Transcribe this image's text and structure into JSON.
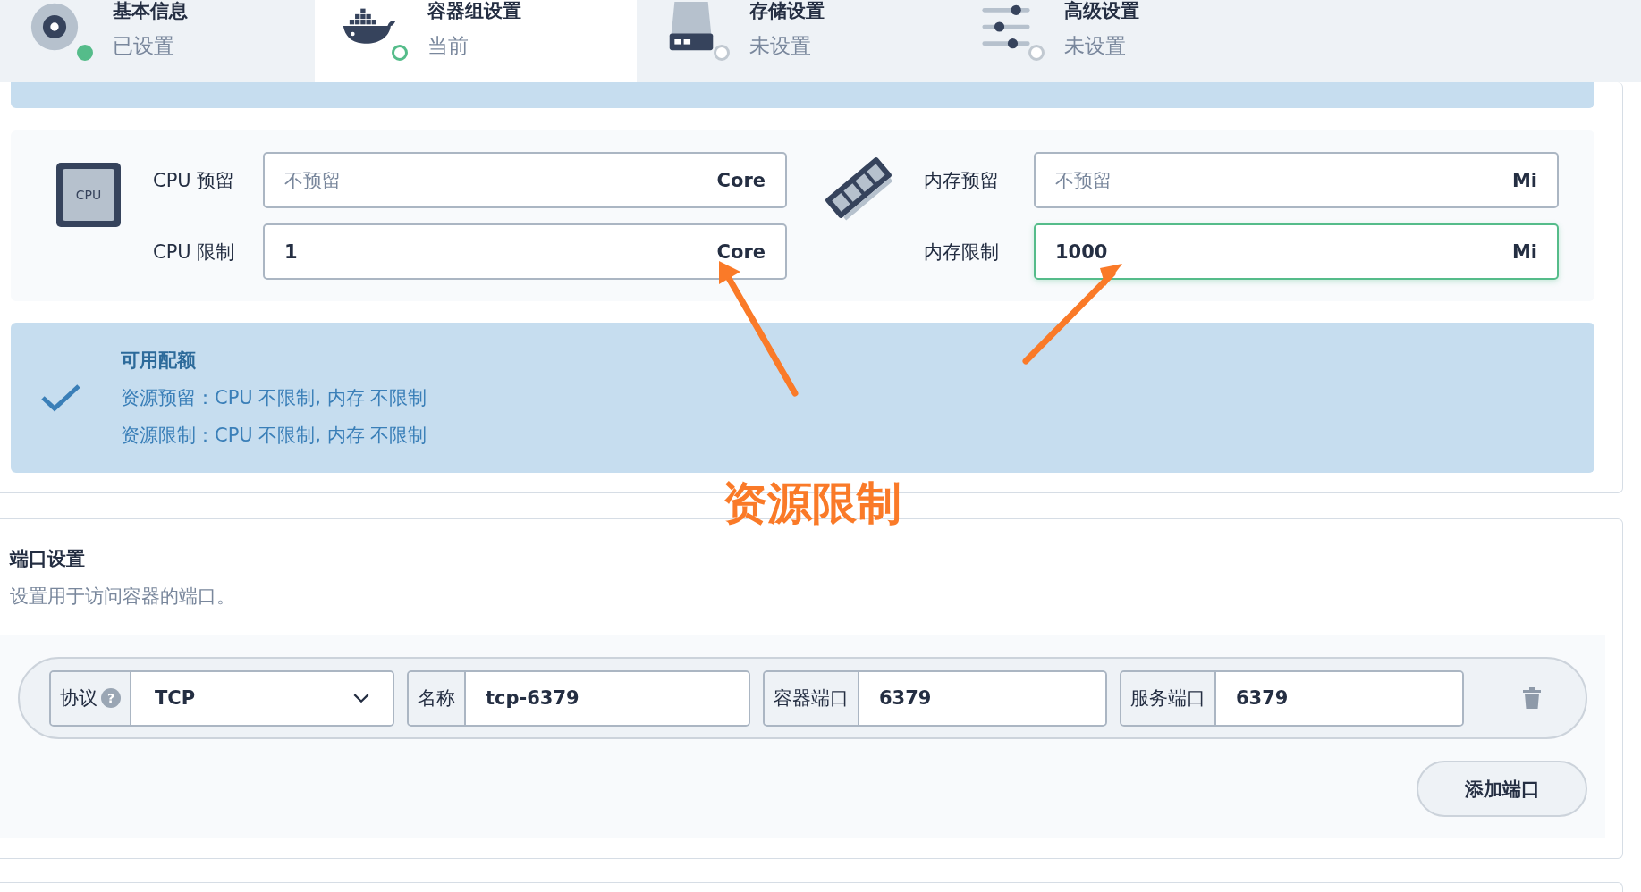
{
  "steps": [
    {
      "kind": "disk",
      "title": "基本信息",
      "status_text": "已设置",
      "completed": true,
      "selected": false
    },
    {
      "kind": "whale",
      "title": "容器组设置",
      "status_text": "当前",
      "completed": false,
      "selected": true
    },
    {
      "kind": "storage",
      "title": "存储设置",
      "status_text": "未设置",
      "completed": false,
      "selected": false
    },
    {
      "kind": "sliders",
      "title": "高级设置",
      "status_text": "未设置",
      "completed": false,
      "selected": false
    }
  ],
  "resources": {
    "cpu_icon_text": "CPU",
    "cpu": [
      {
        "label": "CPU 预留",
        "placeholder": "不预留",
        "unit": "Core",
        "focused": false
      },
      {
        "label": "CPU 限制",
        "value": "1",
        "unit": "Core",
        "focused": false
      }
    ],
    "memory": [
      {
        "label": "内存预留",
        "placeholder": "不预留",
        "unit": "Mi",
        "focused": false
      },
      {
        "label": "内存限制",
        "value": "1000",
        "unit": "Mi",
        "focused": true
      }
    ]
  },
  "quota": {
    "title": "可用配额",
    "lines": [
      "资源预留：CPU 不限制, 内存 不限制",
      "资源限制：CPU 不限制, 内存 不限制"
    ]
  },
  "annotation": {
    "text": "资源限制"
  },
  "ports": {
    "title": "端口设置",
    "description": "设置用于访问容器的端口。",
    "rows": [
      {
        "protocol_label": "协议",
        "help": "?",
        "protocol": "TCP",
        "name_label": "名称",
        "name": "tcp-6379",
        "container_port_label": "容器端口",
        "container_port": "6379",
        "service_port_label": "服务端口",
        "service_port": "6379"
      }
    ],
    "add_button": "添加端口"
  }
}
